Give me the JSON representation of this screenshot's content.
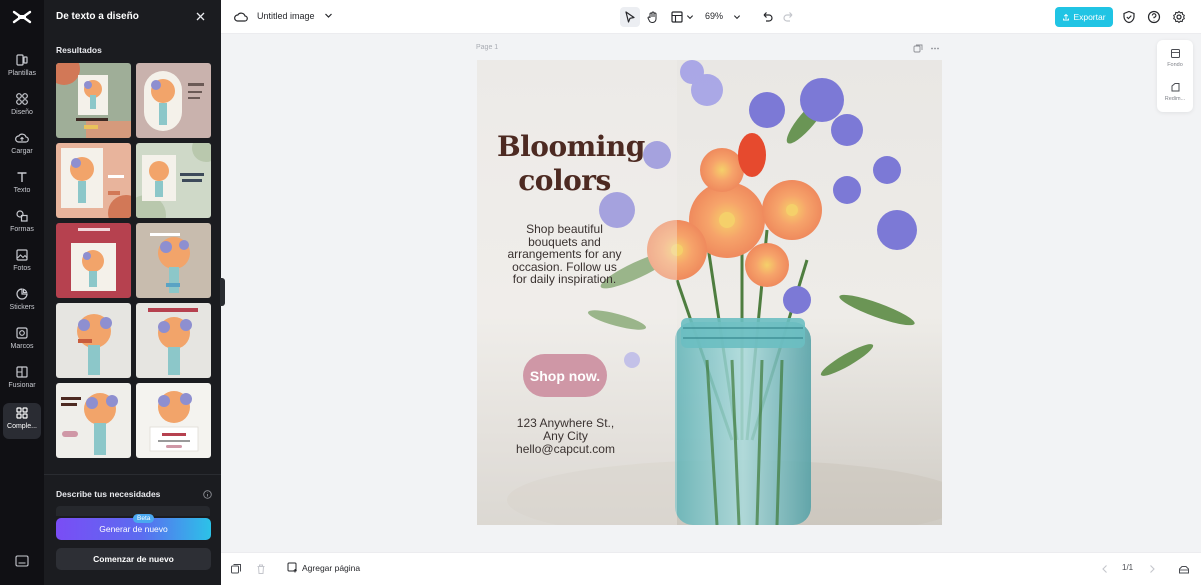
{
  "app": {
    "document_title": "Untitled image",
    "zoom_label": "69%",
    "export_label": "Exportar"
  },
  "rail": {
    "items": [
      {
        "label": "Plantillas",
        "icon": "templates-icon"
      },
      {
        "label": "Diseño",
        "icon": "design-icon"
      },
      {
        "label": "Cargar",
        "icon": "upload-icon"
      },
      {
        "label": "Texto",
        "icon": "text-icon"
      },
      {
        "label": "Formas",
        "icon": "shapes-icon"
      },
      {
        "label": "Fotos",
        "icon": "photos-icon"
      },
      {
        "label": "Stickers",
        "icon": "stickers-icon"
      },
      {
        "label": "Marcos",
        "icon": "frames-icon"
      },
      {
        "label": "Fusionar",
        "icon": "merge-icon"
      },
      {
        "label": "Comple...",
        "icon": "plugins-icon"
      }
    ]
  },
  "panel": {
    "title": "De texto a diseño",
    "results_label": "Resultados",
    "describe_label": "Describe tus necesidades",
    "generate_label": "Generar de nuevo",
    "beta_label": "Beta",
    "restart_label": "Comenzar de nuevo"
  },
  "canvas": {
    "page_label": "Page 1",
    "headline_line1": "Blooming",
    "headline_line2": "colors",
    "body_copy": "Shop beautiful bouquets and arrangements for any occasion. Follow us for daily inspiration.",
    "cta_label": "Shop now.",
    "address_line1": "123 Anywhere St.,",
    "address_line2": "Any City",
    "address_line3": "hello@capcut.com"
  },
  "side_tools": {
    "background_label": "Fondo",
    "resize_label": "Redim..."
  },
  "bottom": {
    "add_page_label": "Agregar página",
    "page_count": "1/1"
  },
  "colors": {
    "accent": "#20c4e4",
    "panel_bg": "#1b1c20",
    "rail_bg": "#101014",
    "headline": "#4d2a22",
    "cta": "#cf97a6"
  }
}
